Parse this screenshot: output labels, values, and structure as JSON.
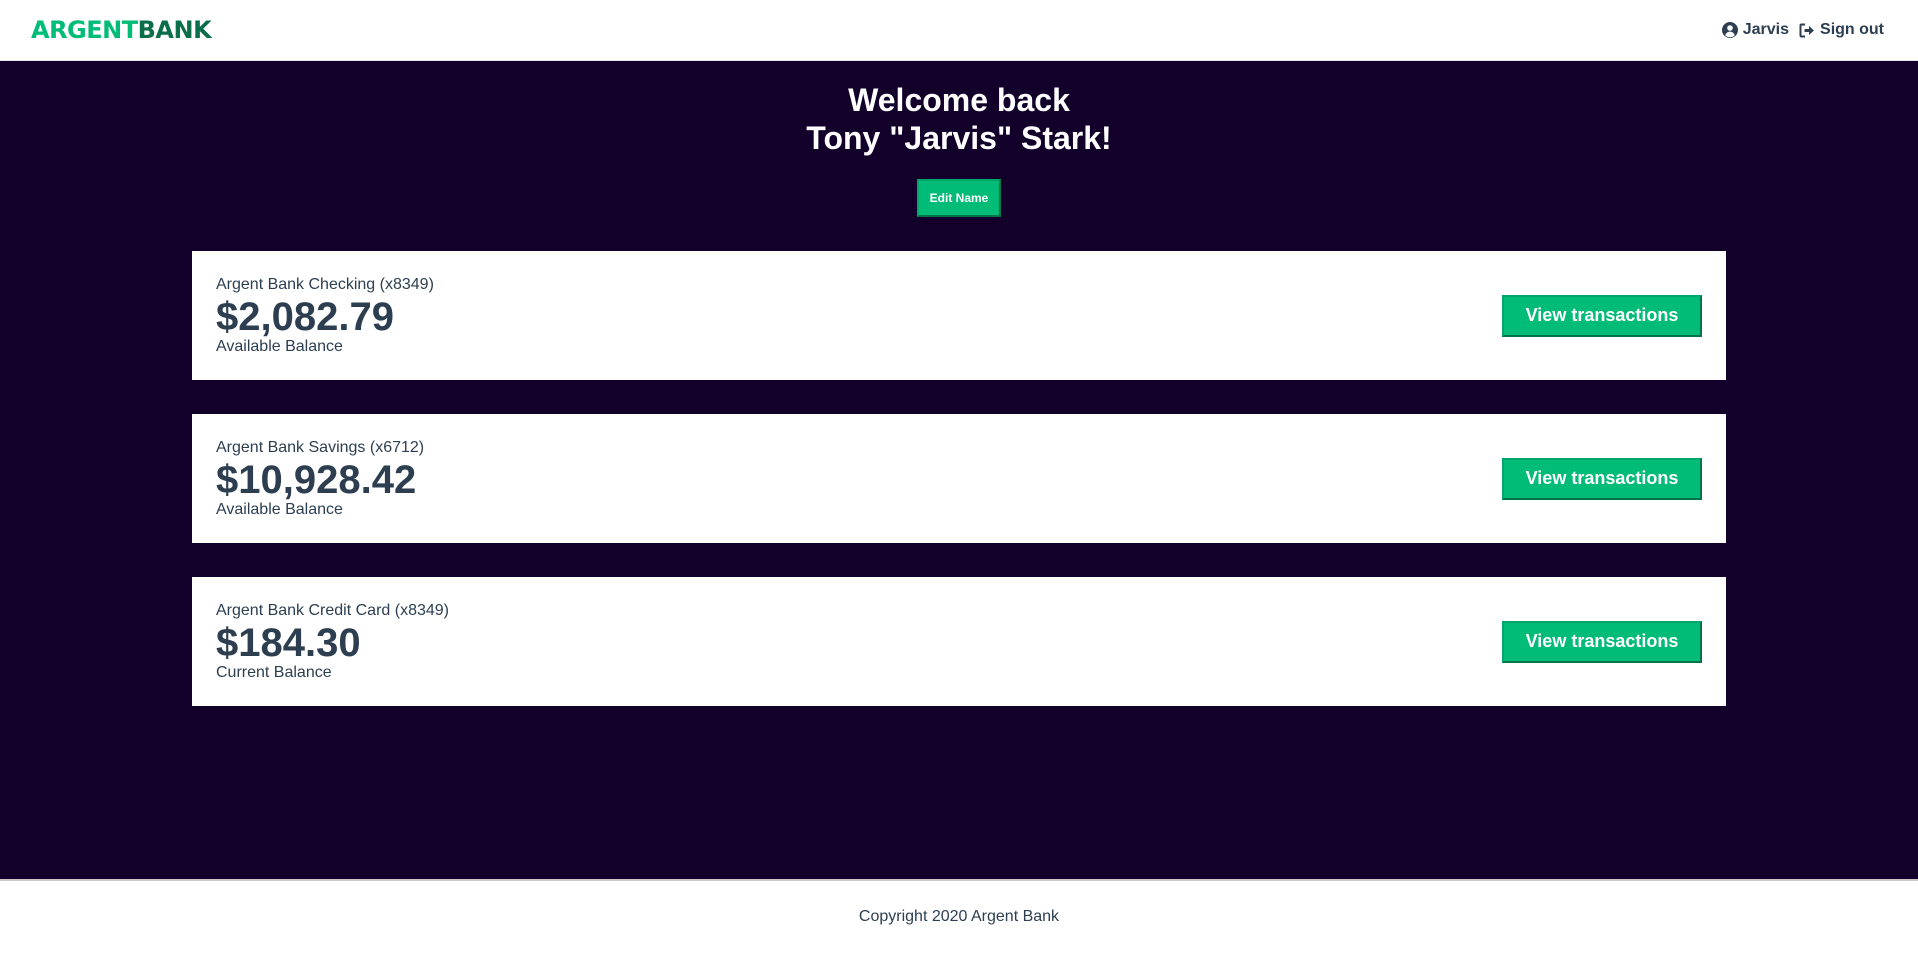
{
  "header": {
    "logo_part1": "ARGENT",
    "logo_part2": "BANK",
    "user_label": "Jarvis",
    "signout_label": "Sign out",
    "user_icon": "user-circle-icon",
    "signout_icon": "sign-out-icon"
  },
  "main": {
    "welcome_line1": "Welcome back",
    "welcome_line2": "Tony \"Jarvis\" Stark!",
    "edit_name_label": "Edit Name",
    "accounts": [
      {
        "title": "Argent Bank Checking (x8349)",
        "amount": "$2,082.79",
        "description": "Available Balance",
        "button_label": "View transactions"
      },
      {
        "title": "Argent Bank Savings (x6712)",
        "amount": "$10,928.42",
        "description": "Available Balance",
        "button_label": "View transactions"
      },
      {
        "title": "Argent Bank Credit Card (x8349)",
        "amount": "$184.30",
        "description": "Current Balance",
        "button_label": "View transactions"
      }
    ]
  },
  "footer": {
    "copyright": "Copyright 2020 Argent Bank"
  },
  "colors": {
    "accent": "#00bc77",
    "background_dark": "#12002b",
    "text": "#2c3e50"
  }
}
